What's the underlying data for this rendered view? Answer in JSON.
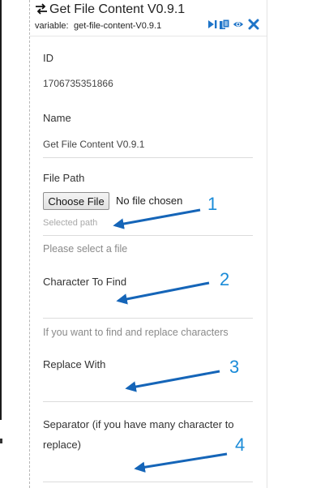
{
  "header": {
    "title": "Get File Content V0.9.1",
    "variable_label": "variable:",
    "variable_value": "get-file-content-V0.9.1",
    "icons": [
      "swap-arrows-icon",
      "run-step-icon",
      "copy-icon",
      "view-icon",
      "close-icon"
    ]
  },
  "fields": {
    "id": {
      "label": "ID",
      "value": "1706735351866"
    },
    "name": {
      "label": "Name",
      "value": "Get File Content V0.9.1"
    },
    "file_path": {
      "label": "File Path",
      "button_label": "Choose File",
      "status": "No file chosen",
      "selected_path": "Selected path",
      "hint": "Please select a file"
    },
    "character_to_find": {
      "label": "Character To Find",
      "value": "",
      "hint": "If you want to find and replace characters"
    },
    "replace_with": {
      "label": "Replace With",
      "value": ""
    },
    "separator": {
      "label_line1": "Separator (if you have many character to",
      "label_line2": "replace)",
      "value": ""
    }
  },
  "annotations": {
    "numbers": [
      "1",
      "2",
      "3",
      "4"
    ],
    "color": "#1a8bd8",
    "arrow_color": "#1565b8"
  },
  "colors": {
    "icon_blue": "#1e74c8",
    "hint_gray": "#8a8a8a",
    "divider": "#dcdcdc"
  }
}
